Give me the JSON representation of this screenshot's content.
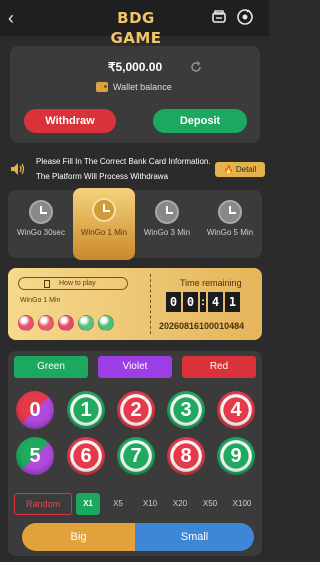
{
  "header": {
    "logo_text": "BDG GAME"
  },
  "wallet": {
    "balance": "₹5,000.00",
    "label": "Wallet balance",
    "withdraw_label": "Withdraw",
    "deposit_label": "Deposit"
  },
  "notice": {
    "text": "Please Fill In The Correct Bank Card Information. The Platform Will Process Withdrawa",
    "detail_label": "Detail"
  },
  "modes": [
    {
      "label": "WinGo 30sec",
      "active": false
    },
    {
      "label": "WinGo 1 Min",
      "active": true
    },
    {
      "label": "WinGo 3 Min",
      "active": false
    },
    {
      "label": "WinGo 5 Min",
      "active": false
    }
  ],
  "round": {
    "how_to_play": "How to play",
    "game_name": "WinGo 1 Min",
    "time_label": "Time remaining",
    "timer": [
      "0",
      "0",
      ":",
      "4",
      "1"
    ],
    "period": "20260816100010484",
    "recent": [
      "#e9546b",
      "#e95a6b",
      "#e84a6b",
      "#5dc07a",
      "#4fbf70"
    ]
  },
  "colors": {
    "green_label": "Green",
    "violet_label": "Violet",
    "red_label": "Red",
    "green": "#1aa95e",
    "violet": "#9b3ee6",
    "red": "#d9323a"
  },
  "numbers": [
    "0",
    "1",
    "2",
    "3",
    "4",
    "5",
    "6",
    "7",
    "8",
    "9"
  ],
  "multipliers": {
    "random_label": "Random",
    "items": [
      "X1",
      "X5",
      "X10",
      "X20",
      "X50",
      "X100"
    ]
  },
  "bigsmall": {
    "big_label": "Big",
    "small_label": "Small"
  }
}
